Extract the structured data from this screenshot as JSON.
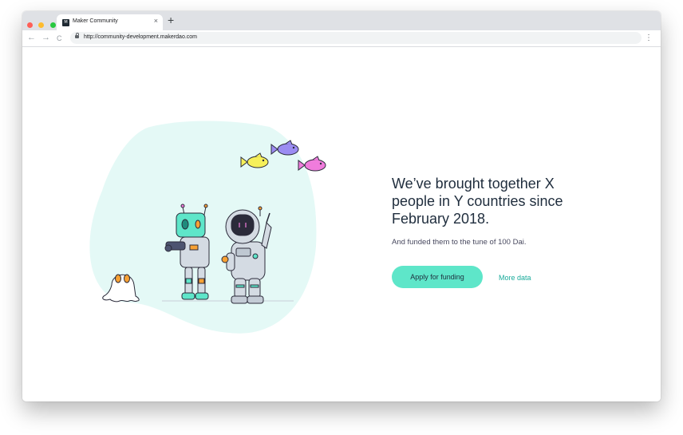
{
  "browser": {
    "traffic_lights": {
      "close": "#ff5f57",
      "minimize": "#febc2e",
      "maximize": "#28c840"
    },
    "tab": {
      "title": "Maker Community",
      "favicon_text": "M",
      "close_icon": "×"
    },
    "new_tab_icon": "+",
    "nav": {
      "back_icon": "←",
      "forward_icon": "→",
      "reload_icon": "C"
    },
    "url": "http://community-development.makerdao.com",
    "menu_icon": "⋮"
  },
  "hero": {
    "headline": "We’ve brought together X people in Y countries since February 2018.",
    "subtext": "And funded them to the tune of 100 Dai.",
    "primary_button": "Apply for funding",
    "secondary_link": "More data"
  },
  "colors": {
    "accent": "#5ee6c9",
    "link": "#1aab9b",
    "blob": "#e4f9f6",
    "heading": "#1f2d3d"
  }
}
